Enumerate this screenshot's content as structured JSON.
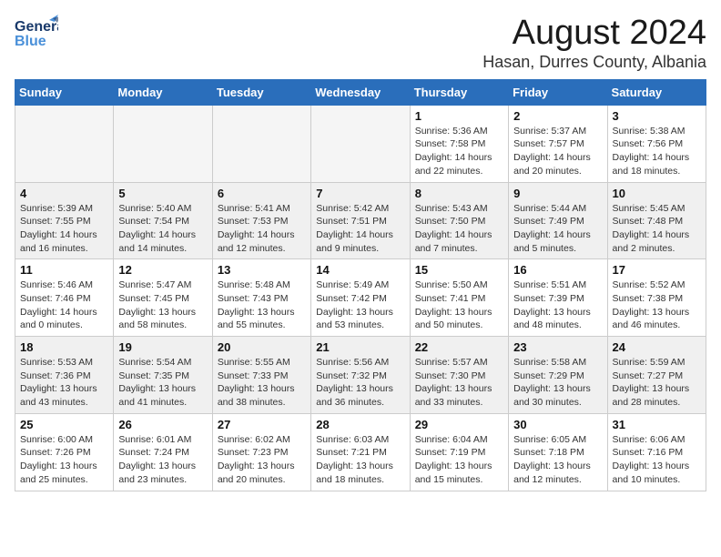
{
  "header": {
    "title": "August 2024",
    "subtitle": "Hasan, Durres County, Albania",
    "logo_general": "General",
    "logo_blue": "Blue"
  },
  "weekdays": [
    "Sunday",
    "Monday",
    "Tuesday",
    "Wednesday",
    "Thursday",
    "Friday",
    "Saturday"
  ],
  "weeks": [
    [
      {
        "day": "",
        "info": ""
      },
      {
        "day": "",
        "info": ""
      },
      {
        "day": "",
        "info": ""
      },
      {
        "day": "",
        "info": ""
      },
      {
        "day": "1",
        "info": "Sunrise: 5:36 AM\nSunset: 7:58 PM\nDaylight: 14 hours\nand 22 minutes."
      },
      {
        "day": "2",
        "info": "Sunrise: 5:37 AM\nSunset: 7:57 PM\nDaylight: 14 hours\nand 20 minutes."
      },
      {
        "day": "3",
        "info": "Sunrise: 5:38 AM\nSunset: 7:56 PM\nDaylight: 14 hours\nand 18 minutes."
      }
    ],
    [
      {
        "day": "4",
        "info": "Sunrise: 5:39 AM\nSunset: 7:55 PM\nDaylight: 14 hours\nand 16 minutes."
      },
      {
        "day": "5",
        "info": "Sunrise: 5:40 AM\nSunset: 7:54 PM\nDaylight: 14 hours\nand 14 minutes."
      },
      {
        "day": "6",
        "info": "Sunrise: 5:41 AM\nSunset: 7:53 PM\nDaylight: 14 hours\nand 12 minutes."
      },
      {
        "day": "7",
        "info": "Sunrise: 5:42 AM\nSunset: 7:51 PM\nDaylight: 14 hours\nand 9 minutes."
      },
      {
        "day": "8",
        "info": "Sunrise: 5:43 AM\nSunset: 7:50 PM\nDaylight: 14 hours\nand 7 minutes."
      },
      {
        "day": "9",
        "info": "Sunrise: 5:44 AM\nSunset: 7:49 PM\nDaylight: 14 hours\nand 5 minutes."
      },
      {
        "day": "10",
        "info": "Sunrise: 5:45 AM\nSunset: 7:48 PM\nDaylight: 14 hours\nand 2 minutes."
      }
    ],
    [
      {
        "day": "11",
        "info": "Sunrise: 5:46 AM\nSunset: 7:46 PM\nDaylight: 14 hours\nand 0 minutes."
      },
      {
        "day": "12",
        "info": "Sunrise: 5:47 AM\nSunset: 7:45 PM\nDaylight: 13 hours\nand 58 minutes."
      },
      {
        "day": "13",
        "info": "Sunrise: 5:48 AM\nSunset: 7:43 PM\nDaylight: 13 hours\nand 55 minutes."
      },
      {
        "day": "14",
        "info": "Sunrise: 5:49 AM\nSunset: 7:42 PM\nDaylight: 13 hours\nand 53 minutes."
      },
      {
        "day": "15",
        "info": "Sunrise: 5:50 AM\nSunset: 7:41 PM\nDaylight: 13 hours\nand 50 minutes."
      },
      {
        "day": "16",
        "info": "Sunrise: 5:51 AM\nSunset: 7:39 PM\nDaylight: 13 hours\nand 48 minutes."
      },
      {
        "day": "17",
        "info": "Sunrise: 5:52 AM\nSunset: 7:38 PM\nDaylight: 13 hours\nand 46 minutes."
      }
    ],
    [
      {
        "day": "18",
        "info": "Sunrise: 5:53 AM\nSunset: 7:36 PM\nDaylight: 13 hours\nand 43 minutes."
      },
      {
        "day": "19",
        "info": "Sunrise: 5:54 AM\nSunset: 7:35 PM\nDaylight: 13 hours\nand 41 minutes."
      },
      {
        "day": "20",
        "info": "Sunrise: 5:55 AM\nSunset: 7:33 PM\nDaylight: 13 hours\nand 38 minutes."
      },
      {
        "day": "21",
        "info": "Sunrise: 5:56 AM\nSunset: 7:32 PM\nDaylight: 13 hours\nand 36 minutes."
      },
      {
        "day": "22",
        "info": "Sunrise: 5:57 AM\nSunset: 7:30 PM\nDaylight: 13 hours\nand 33 minutes."
      },
      {
        "day": "23",
        "info": "Sunrise: 5:58 AM\nSunset: 7:29 PM\nDaylight: 13 hours\nand 30 minutes."
      },
      {
        "day": "24",
        "info": "Sunrise: 5:59 AM\nSunset: 7:27 PM\nDaylight: 13 hours\nand 28 minutes."
      }
    ],
    [
      {
        "day": "25",
        "info": "Sunrise: 6:00 AM\nSunset: 7:26 PM\nDaylight: 13 hours\nand 25 minutes."
      },
      {
        "day": "26",
        "info": "Sunrise: 6:01 AM\nSunset: 7:24 PM\nDaylight: 13 hours\nand 23 minutes."
      },
      {
        "day": "27",
        "info": "Sunrise: 6:02 AM\nSunset: 7:23 PM\nDaylight: 13 hours\nand 20 minutes."
      },
      {
        "day": "28",
        "info": "Sunrise: 6:03 AM\nSunset: 7:21 PM\nDaylight: 13 hours\nand 18 minutes."
      },
      {
        "day": "29",
        "info": "Sunrise: 6:04 AM\nSunset: 7:19 PM\nDaylight: 13 hours\nand 15 minutes."
      },
      {
        "day": "30",
        "info": "Sunrise: 6:05 AM\nSunset: 7:18 PM\nDaylight: 13 hours\nand 12 minutes."
      },
      {
        "day": "31",
        "info": "Sunrise: 6:06 AM\nSunset: 7:16 PM\nDaylight: 13 hours\nand 10 minutes."
      }
    ]
  ]
}
